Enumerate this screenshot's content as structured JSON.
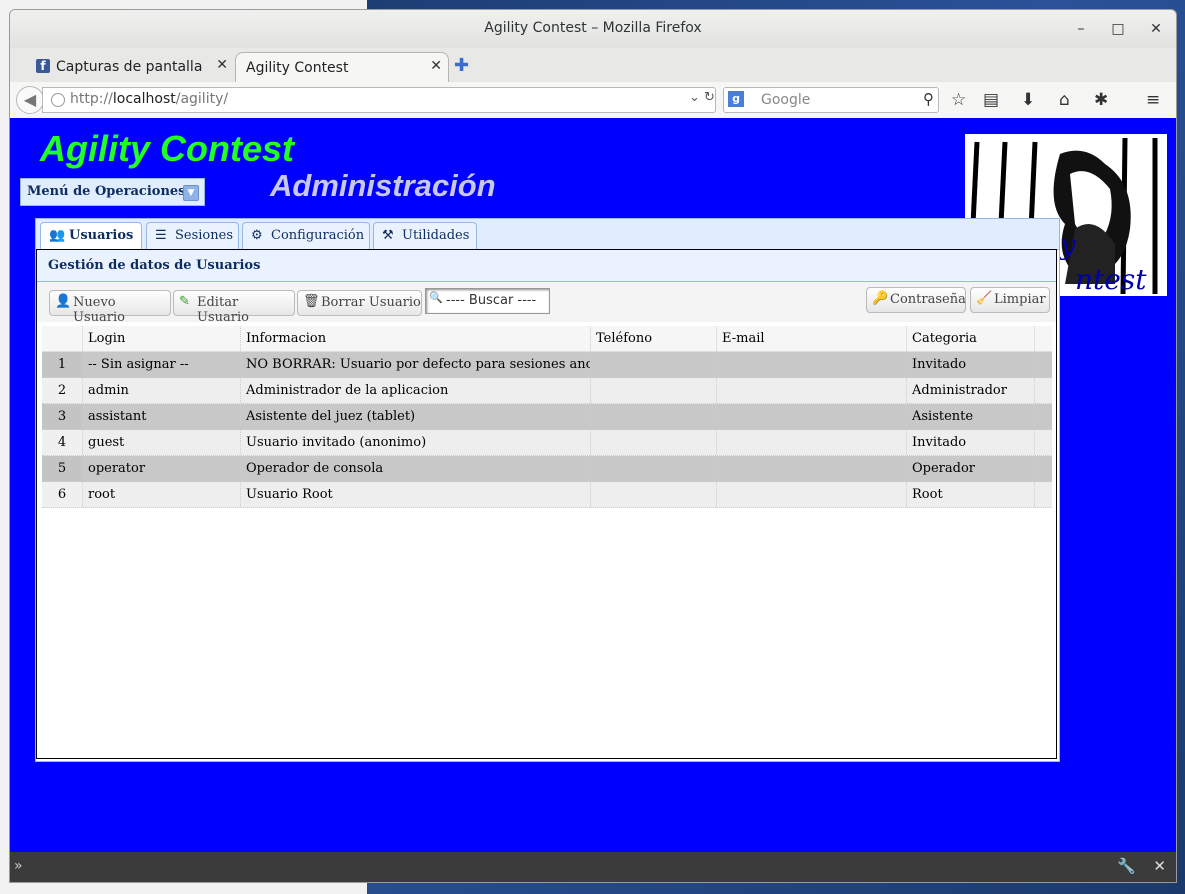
{
  "browser": {
    "window_title": "Agility Contest – Mozilla Firefox",
    "tabs": [
      {
        "label": "Capturas de pantalla"
      },
      {
        "label": "Agility Contest"
      }
    ],
    "url_prefix": "http://",
    "url_host": "localhost",
    "url_path": "/agility/",
    "search_placeholder": "Google"
  },
  "page": {
    "brand": "Agility Contest",
    "subtitle": "Administración",
    "operations_menu": "Menú de Operaciones",
    "tabs": [
      {
        "label": "Usuarios",
        "selected": true,
        "icon": "users-icon"
      },
      {
        "label": "Sesiones",
        "icon": "list-icon"
      },
      {
        "label": "Configuración",
        "icon": "gear-icon"
      },
      {
        "label": "Utilidades",
        "icon": "tools-icon"
      }
    ],
    "panel_title": "Gestión de datos de Usuarios",
    "toolbar": {
      "new_user": "Nuevo Usuario",
      "edit_user": "Editar Usuario",
      "delete_user": "Borrar Usuario",
      "search": "---- Buscar ----",
      "password": "Contraseña",
      "clear": "Limpiar"
    },
    "grid": {
      "columns": [
        "Login",
        "Informacion",
        "Teléfono",
        "E-mail",
        "Categoria"
      ],
      "rows": [
        {
          "n": "1",
          "login": "-- Sin asignar --",
          "info": "NO BORRAR: Usuario por defecto para sesiones anonimas",
          "phone": "",
          "email": "",
          "category": "Invitado"
        },
        {
          "n": "2",
          "login": "admin",
          "info": "Administrador de la aplicacion",
          "phone": "",
          "email": "",
          "category": "Administrador"
        },
        {
          "n": "3",
          "login": "assistant",
          "info": "Asistente del juez (tablet)",
          "phone": "",
          "email": "",
          "category": "Asistente"
        },
        {
          "n": "4",
          "login": "guest",
          "info": "Usuario invitado (anonimo)",
          "phone": "",
          "email": "",
          "category": "Invitado"
        },
        {
          "n": "5",
          "login": "operator",
          "info": "Operador de consola",
          "phone": "",
          "email": "",
          "category": "Operador"
        },
        {
          "n": "6",
          "login": "root",
          "info": "Usuario Root",
          "phone": "",
          "email": "",
          "category": "Root"
        }
      ]
    }
  },
  "colors": {
    "page_background": "#0000ff",
    "brand": "#22ff22",
    "subtitle": "#c8c8e8",
    "row_odd": "#c8c8c8",
    "row_even": "#eeeeee"
  }
}
